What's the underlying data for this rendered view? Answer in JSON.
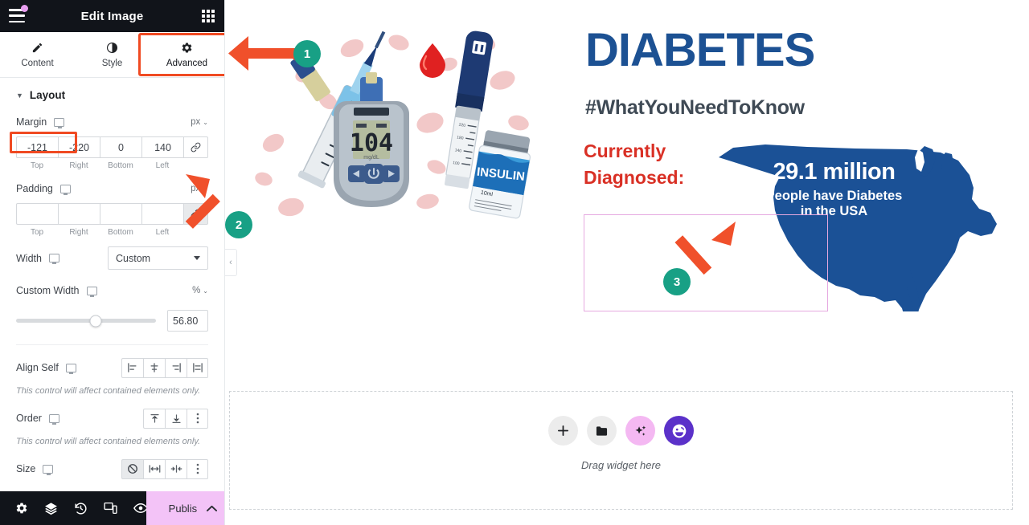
{
  "panel": {
    "header": {
      "title": "Edit Image",
      "menu_icon": "hamburger-menu-icon",
      "grid_icon": "apps-grid-icon",
      "notification_dot_color": "#e89ef0"
    },
    "tabs": [
      {
        "label": "Content",
        "icon": "pencil-icon",
        "active": false
      },
      {
        "label": "Style",
        "icon": "contrast-half-circle-icon",
        "active": false
      },
      {
        "label": "Advanced",
        "icon": "gear-icon",
        "active": true
      }
    ],
    "section": {
      "title": "Layout",
      "collapsed": false
    },
    "margin": {
      "label": "Margin",
      "unit": "px",
      "values": {
        "top": "-121",
        "right": "-220",
        "bottom": "0",
        "left": "140"
      },
      "captions": {
        "top": "Top",
        "right": "Right",
        "bottom": "Bottom",
        "left": "Left"
      },
      "link_icon": "link-chain-icon",
      "linked": false
    },
    "padding": {
      "label": "Padding",
      "unit": "px",
      "values": {
        "top": "",
        "right": "",
        "bottom": "",
        "left": ""
      },
      "captions": {
        "top": "Top",
        "right": "Right",
        "bottom": "Bottom",
        "left": "Left"
      },
      "link_icon": "link-chain-icon",
      "linked": true
    },
    "width": {
      "label": "Width",
      "value": "Custom"
    },
    "custom_width": {
      "label": "Custom Width",
      "unit": "%",
      "value": "56.80",
      "slider_percent": 56.8
    },
    "align_self": {
      "label": "Align Self",
      "hint": "This control will affect contained elements only.",
      "options": [
        "align-start-icon",
        "align-center-icon",
        "align-end-icon",
        "align-stretch-icon"
      ]
    },
    "order": {
      "label": "Order",
      "hint": "This control will affect contained elements only.",
      "options": [
        "order-first-icon",
        "order-last-icon",
        "more-vertical-icon"
      ]
    },
    "size": {
      "label": "Size",
      "options": [
        "none-slash-icon",
        "grow-icon",
        "shrink-icon",
        "more-vertical-icon"
      ],
      "selected_index": 0
    },
    "bottom_bar": {
      "icons": [
        "settings-gear-icon",
        "layers-navigator-icon",
        "history-clock-icon",
        "responsive-devices-icon",
        "preview-eye-icon"
      ],
      "publish_label": "Publish",
      "publish_chevron": "chevron-up-icon",
      "publish_bg": "#f3c3f7"
    }
  },
  "canvas": {
    "collapse_icon": "chevron-left-icon",
    "illustration": {
      "alt": "diabetes-supplies-illustration",
      "meter_reading": "104",
      "meter_unit": "mg/dL",
      "insulin_label": "INSULIN",
      "insulin_volume": "10ml"
    },
    "heading": "DIABETES",
    "subheading": "#WhatYouNeedToKnow",
    "currently_diagnosed_line1": "Currently",
    "currently_diagnosed_line2": "Diagnosed:",
    "map_stat": {
      "number": "29.1 million",
      "line2": "People have Diabetes",
      "line3": "in the USA"
    },
    "colors": {
      "heading_blue": "#1c5193",
      "subheading_grey": "#3f4a55",
      "diagnosed_red": "#d93025",
      "map_blue": "#1b5196",
      "selection_pink": "#e6a9e0"
    },
    "drop_zone": {
      "label": "Drag widget here",
      "buttons": [
        "plus-icon",
        "folder-icon",
        "ai-sparkle-icon",
        "elementor-face-icon"
      ]
    }
  },
  "annotations": [
    {
      "number": "1",
      "direction": "left",
      "target": "advanced-tab"
    },
    {
      "number": "2",
      "direction": "up-left",
      "target": "margin-link-button"
    },
    {
      "number": "3",
      "direction": "up-right",
      "target": "image-widget-selection"
    }
  ],
  "annotation_colors": {
    "badge": "#18a085",
    "arrow": "#f0502b",
    "box": "#f04a22"
  }
}
